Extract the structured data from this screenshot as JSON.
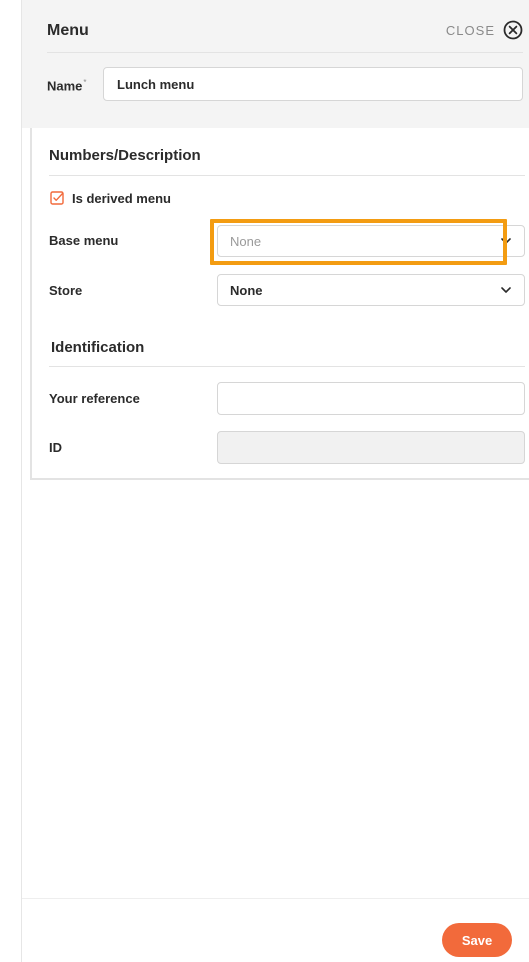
{
  "header": {
    "title": "Menu",
    "close_label": "CLOSE",
    "name_label": "Name",
    "name_required_mark": "*",
    "name_value": "Lunch menu"
  },
  "numbers_section": {
    "title": "Numbers/Description",
    "is_derived_label": "Is derived menu",
    "is_derived_checked": true,
    "base_menu_label": "Base menu",
    "base_menu_value": "None",
    "store_label": "Store",
    "store_value": "None"
  },
  "identification_section": {
    "title": "Identification",
    "your_reference_label": "Your reference",
    "your_reference_value": "",
    "id_label": "ID",
    "id_value": ""
  },
  "footer": {
    "save_label": "Save"
  },
  "colors": {
    "accent": "#f26a3b",
    "highlight": "#f39c12",
    "checkbox": "#f26a3b"
  },
  "icons": {
    "close": "close-circle-icon",
    "checkbox": "checkbox-checked-icon",
    "chevron": "chevron-down-icon"
  }
}
